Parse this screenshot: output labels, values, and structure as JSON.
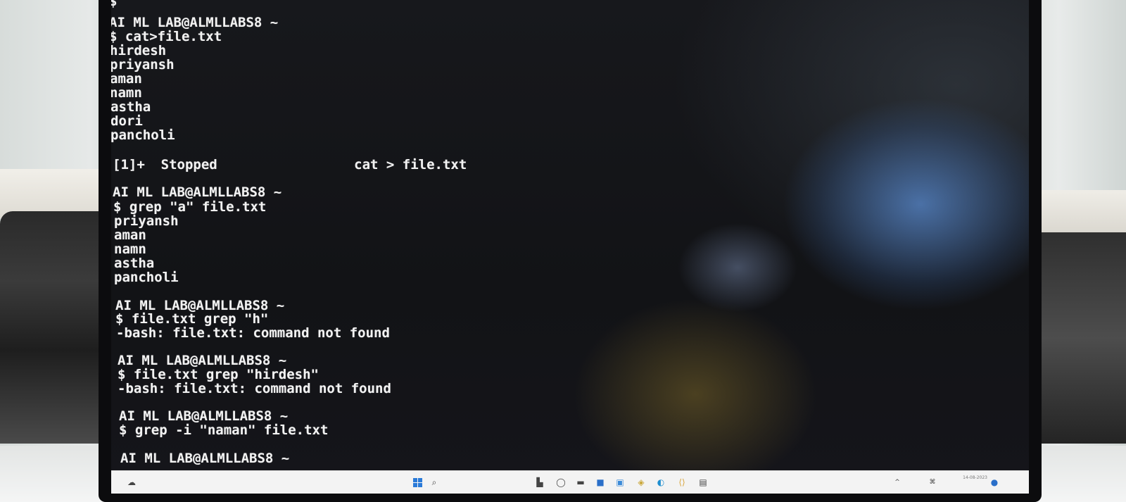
{
  "terminal": {
    "lines": [
      "$",
      "AI ML LAB@ALMLLABS8 ~",
      "$ cat>file.txt",
      "hirdesh",
      "priyansh",
      "aman",
      "namn",
      "astha",
      "dori",
      "pancholi",
      "",
      "[1]+  Stopped                 cat > file.txt",
      "",
      "AI ML LAB@ALMLLABS8 ~",
      "$ grep \"a\" file.txt",
      "priyansh",
      "aman",
      "namn",
      "astha",
      "pancholi",
      "",
      "AI ML LAB@ALMLLABS8 ~",
      "$ file.txt grep \"h\"",
      "-bash: file.txt: command not found",
      "",
      "AI ML LAB@ALMLLABS8 ~",
      "$ file.txt grep \"hirdesh\"",
      "-bash: file.txt: command not found",
      "",
      "AI ML LAB@ALMLLABS8 ~",
      "$ grep -i \"naman\" file.txt",
      "",
      "AI ML LAB@ALMLLABS8 ~"
    ]
  },
  "taskbar": {
    "icons": [
      "widgets-icon",
      "start-icon",
      "search-icon",
      "task-view-icon",
      "chat-icon",
      "file-explorer-icon",
      "store-icon",
      "photos-icon",
      "security-icon",
      "edge-icon",
      "vscode-icon",
      "terminal-app-icon"
    ],
    "tray": {
      "date": "14-08-2023"
    }
  },
  "colors": {
    "terminal_text": "#f2f2f2",
    "terminal_bg": "#131417",
    "taskbar_bg": "#f3f3f3"
  }
}
